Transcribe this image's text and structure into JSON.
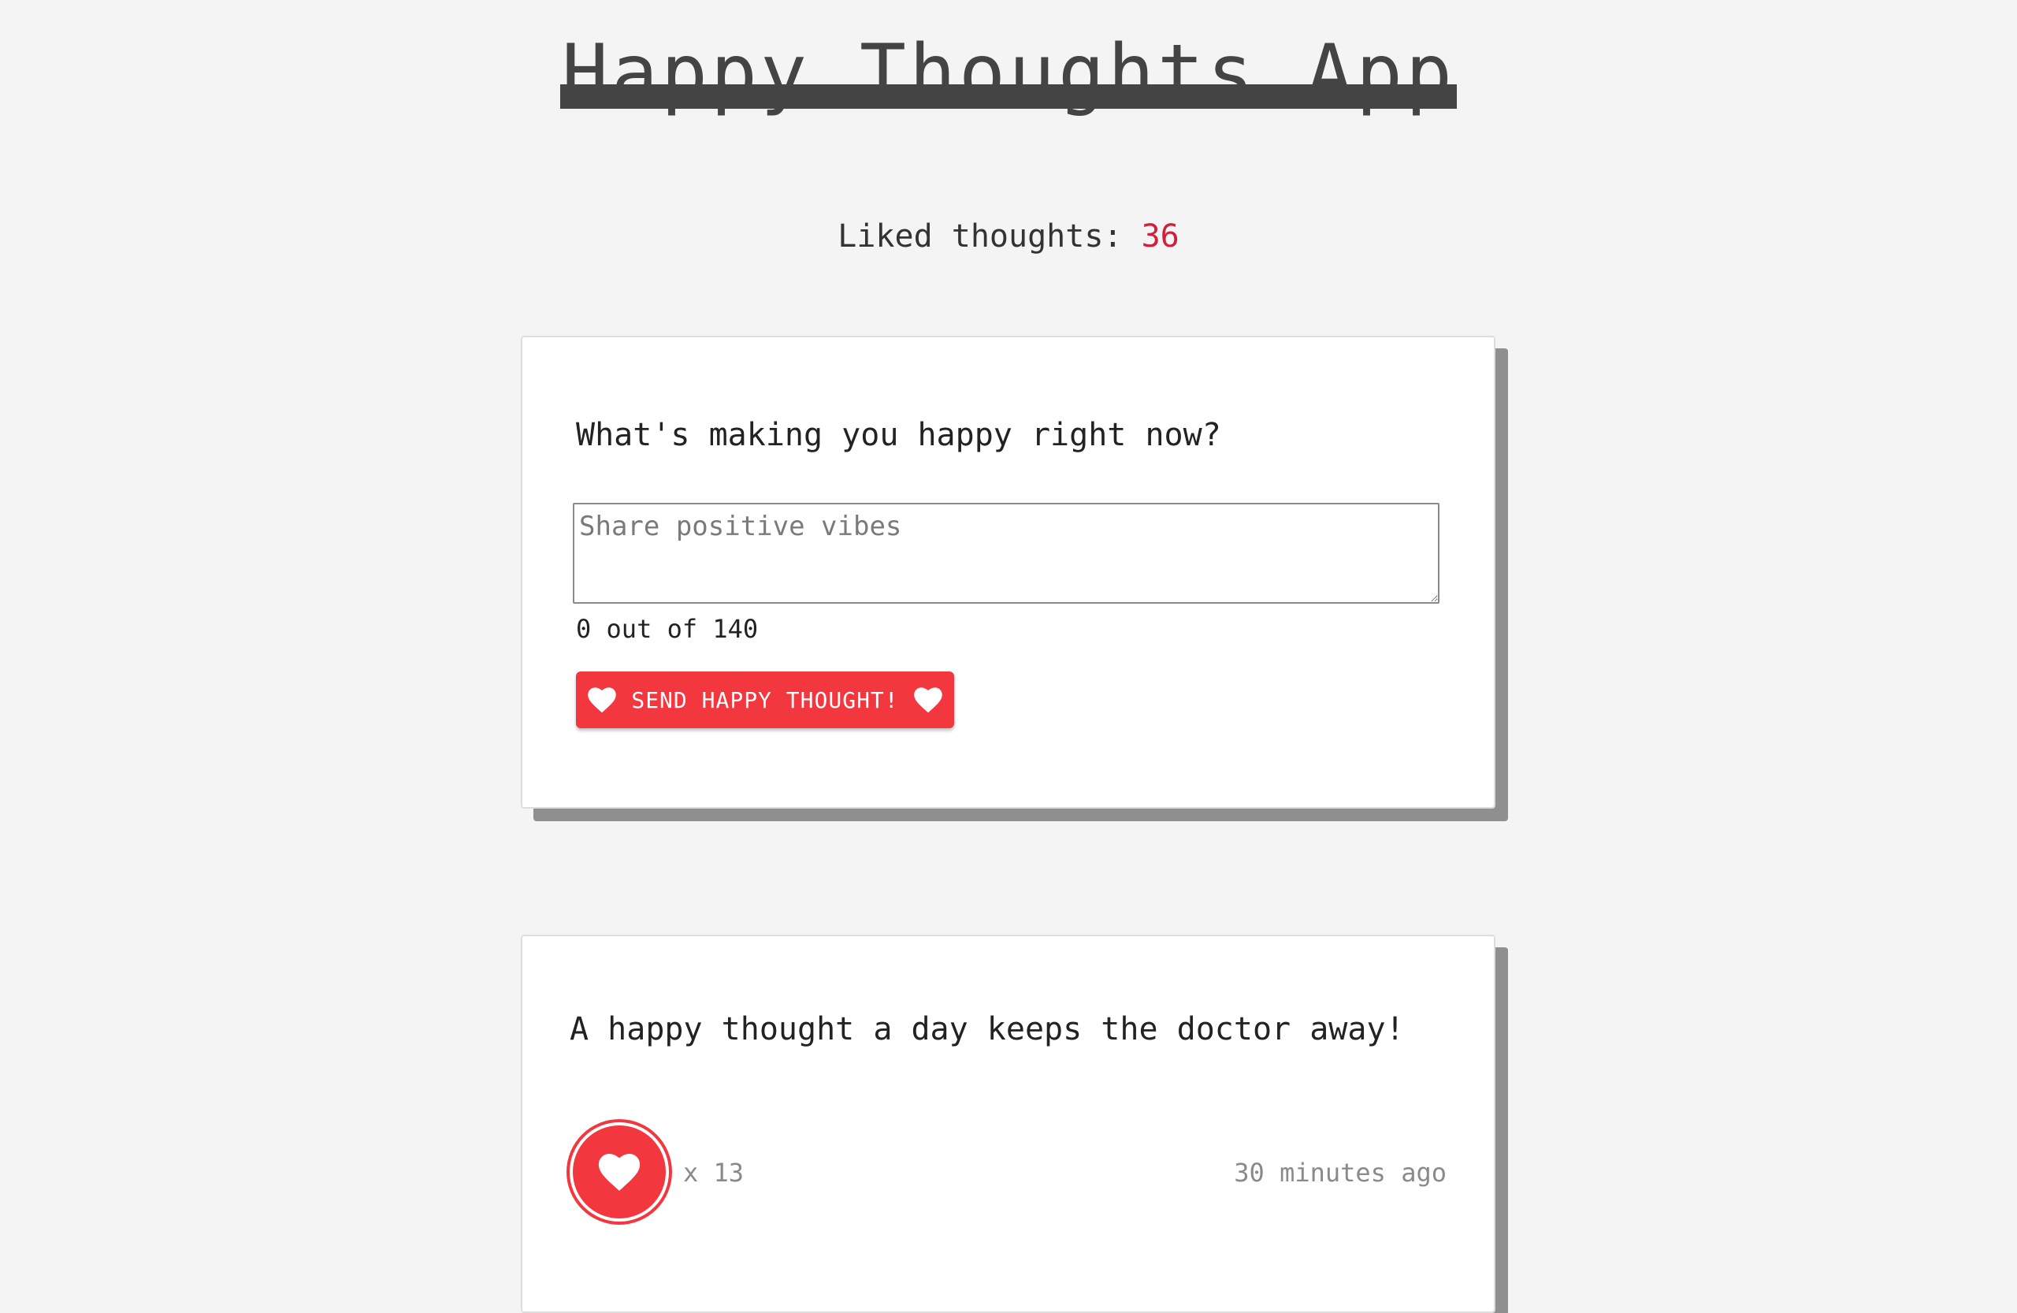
{
  "header": {
    "title": "Happy Thoughts App"
  },
  "liked": {
    "label": "Liked thoughts: ",
    "count": "36"
  },
  "form": {
    "question": "What's making you happy right now?",
    "input_value": "",
    "input_placeholder": "Share positive vibes",
    "char_counter": "0 out of 140",
    "send_label": "SEND HAPPY THOUGHT!"
  },
  "thoughts": [
    {
      "message": "A happy thought a day keeps the doctor away!",
      "like_count": "x 13",
      "time": "30 minutes ago"
    }
  ],
  "colors": {
    "background": "#f4f4f4",
    "accent": "#f3373f",
    "counter": "#d1203a",
    "title": "#444444",
    "muted": "#8a8a8a"
  },
  "icons": {
    "button_left": "heart-icon",
    "button_right": "heart-icon",
    "like": "heart-icon"
  }
}
